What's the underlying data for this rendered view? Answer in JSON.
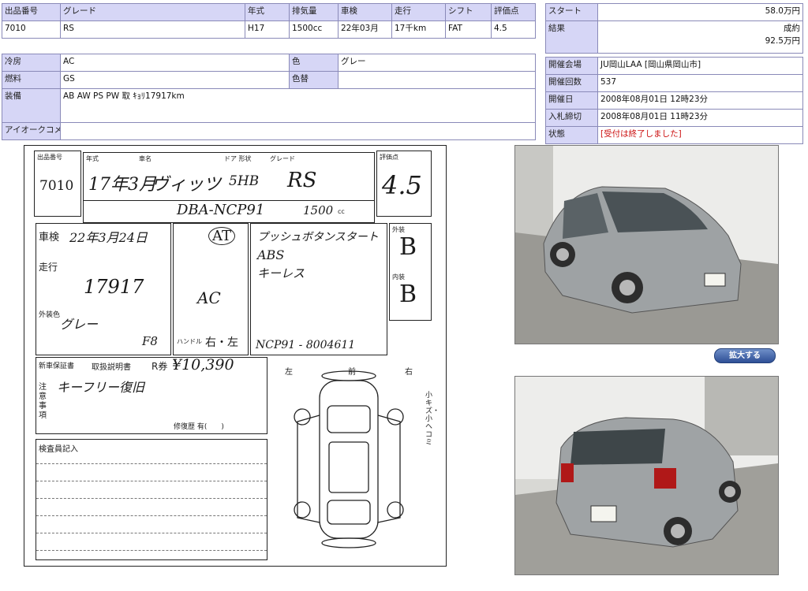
{
  "specs": {
    "headers": [
      "出品番号",
      "グレード",
      "年式",
      "排気量",
      "車検",
      "走行",
      "シフト",
      "評価点"
    ],
    "values": [
      "7010",
      "RS",
      "H17",
      "1500cc",
      "22年03月",
      "17千km",
      "FAT",
      "4.5"
    ]
  },
  "extra": {
    "reizo_label": "冷房",
    "reizo_value": "AC",
    "color_label": "色",
    "color_value": "グレー",
    "fuel_label": "燃料",
    "fuel_value": "GS",
    "color_change_label": "色替",
    "color_change_value": "",
    "equipment_label": "装備",
    "equipment_value": "AB AW PS PW 取 ｷｮﾘ17917km",
    "comment_label": "アイオークコメント",
    "comment_value": ""
  },
  "auction": {
    "start_label": "スタート",
    "start_value": "58.0万円",
    "result_label": "結果",
    "result_status": "成約",
    "result_price": "92.5万円",
    "venue_label": "開催会場",
    "venue_value": "JU岡山LAA [岡山県岡山市]",
    "round_label": "開催回数",
    "round_value": "537",
    "date_label": "開催日",
    "date_value": "2008年08月01日 12時23分",
    "deadline_label": "入札締切",
    "deadline_value": "2008年08月01日 11時23分",
    "status_label": "状態",
    "status_value": "[受付は終了しました]"
  },
  "sheet": {
    "lot_label": "出品番号",
    "lot_number": "7010",
    "year_label": "年式",
    "year_value": "17年3月",
    "car_label": "車名",
    "car_value": "ヴィッツ",
    "door_label": "ドア 形状",
    "door_value": "5HB",
    "grade_label": "グレード",
    "grade_value": "RS",
    "score_label": "評価点",
    "score_value": "4.5",
    "model_value": "DBA-NCP91",
    "cc_value": "1500",
    "unit_cc": "cc",
    "shaken_label": "車検",
    "shaken_value": "22年3月24日",
    "mileage_label": "走行",
    "mileage_value": "17917",
    "gear_value": "AT",
    "aircon_value": "AC",
    "options_value": "プッシュボタンスタート",
    "options_value2": "ABS",
    "options_value3": "キーレス",
    "exterior_label": "外装",
    "exterior_value": "B",
    "interior_label": "内装",
    "interior_value": "B",
    "color_label": "外装色",
    "color_value": "グレー",
    "handle_label": "ハンドル",
    "handle_value": "右・左",
    "chassis_value": "NCP91 - 8004611",
    "recycle_label": "R券",
    "recycle_value": "¥10,390",
    "fuel_code": "F8",
    "notes_label": "注意事項",
    "notes_value": "キーフリー復旧",
    "inspector_label": "検査員記入",
    "manual_label": "取扱説明書",
    "warranty_label": "新車保証書",
    "remarks_label": "修復歴 有(　　)",
    "diagram_front_label": "前",
    "diagram_left_label": "左",
    "diagram_right_label": "右",
    "side_note": "小キズ・小ヘコミ"
  },
  "buttons": {
    "enlarge_label": "拡大する"
  }
}
